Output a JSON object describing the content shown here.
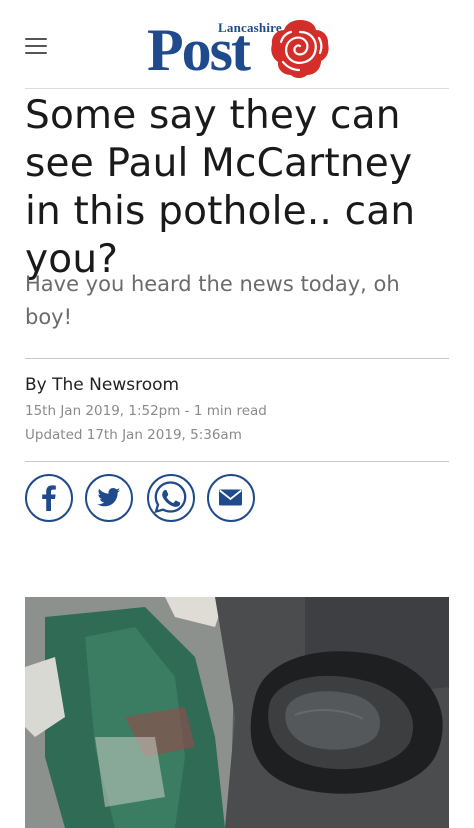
{
  "header": {
    "logo_small": "Lancashire",
    "logo_big": "Post",
    "menu_icon": "hamburger-menu-icon",
    "logo_color": "#1f4a8c",
    "rose_color": "#d42e2a"
  },
  "article": {
    "headline": "Some say they can see Paul McCartney in this pothole.. can you?",
    "standfirst": "Have you heard the news today, oh boy!",
    "byline": "By The Newsroom",
    "published": "15th Jan 2019, 1:52pm - 1 min read",
    "updated": "Updated  17th Jan 2019, 5:36am"
  },
  "share": {
    "icons": [
      "facebook-icon",
      "twitter-icon",
      "whatsapp-icon",
      "email-icon"
    ],
    "accent": "#1f4a8c"
  }
}
